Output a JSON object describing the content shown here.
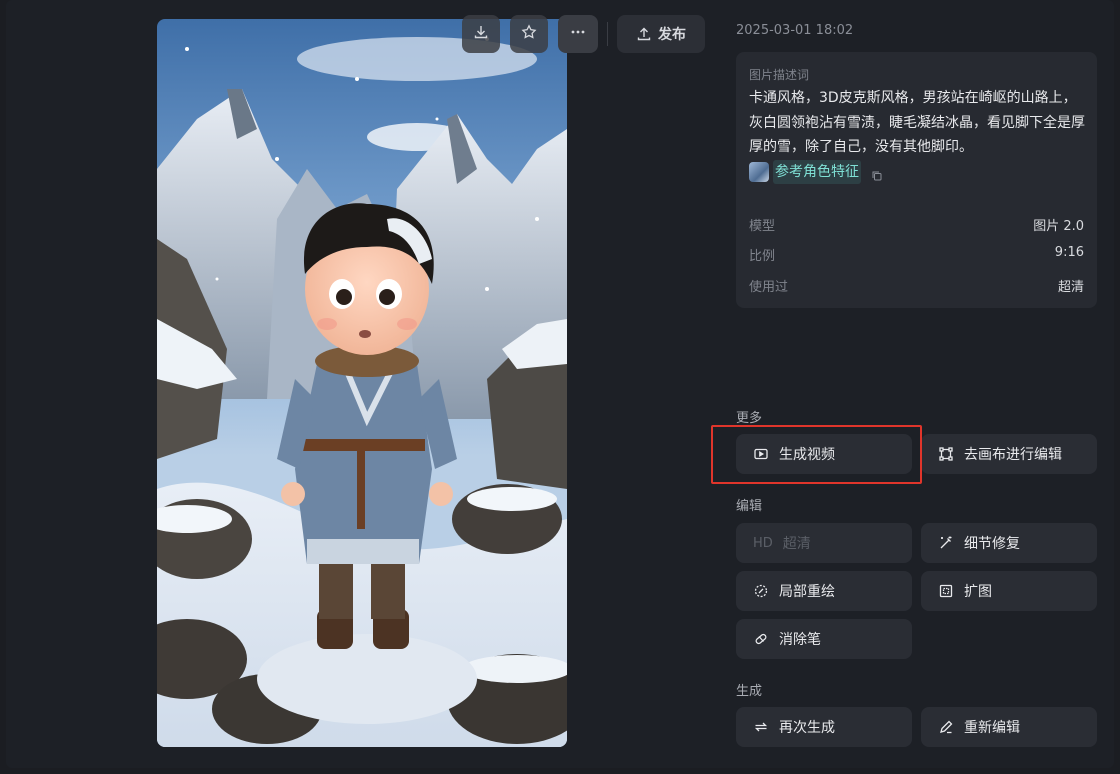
{
  "toolbar": {
    "download_icon": "download-icon",
    "favorite_icon": "star-icon",
    "more_icon": "more-icon",
    "publish_label": "发布"
  },
  "timestamp": "2025-03-01 18:02",
  "description": {
    "label": "图片描述词",
    "text": "卡通风格，3D皮克斯风格，男孩站在崎岖的山路上，灰白圆领袍沾有雪渍，睫毛凝结冰晶，看见脚下全是厚厚的雪，除了自己，没有其他脚印。",
    "ref_link_label": "参考角色特征"
  },
  "meta": [
    {
      "key": "模型",
      "value": "图片 2.0"
    },
    {
      "key": "比例",
      "value": "9:16"
    },
    {
      "key": "使用过",
      "value": "超清"
    }
  ],
  "sections": {
    "more": "更多",
    "edit": "编辑",
    "generate": "生成"
  },
  "actions": {
    "generate_video": "生成视频",
    "canvas_edit": "去画布进行编辑",
    "hd_badge": "HD",
    "hd_label": "超清",
    "detail_repair": "细节修复",
    "partial_redraw": "局部重绘",
    "expand": "扩图",
    "eraser": "消除笔",
    "regenerate": "再次生成",
    "re_edit": "重新编辑"
  },
  "colors": {
    "highlight": "#e0352b",
    "link": "#7fe0d5"
  }
}
